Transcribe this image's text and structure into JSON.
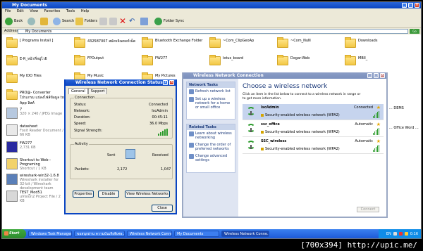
{
  "explorer": {
    "title": "My Documents",
    "menu": [
      "File",
      "Edit",
      "View",
      "Favorites",
      "Tools",
      "Help"
    ],
    "toolbar": {
      "back": "Back",
      "search": "Search",
      "folders": "Folders",
      "folder_sync": "Folder Sync"
    },
    "address_label": "Address",
    "address_value": "My Documents",
    "go": "Go",
    "items": [
      {
        "name": "[ Programs Install ]",
        "sub": "",
        "type": "folder"
      },
      {
        "name": "432587007 สมัครอินเทอร์เน็ต",
        "sub": "",
        "type": "folder"
      },
      {
        "name": "Bluetooth Exchange Folder",
        "sub": "",
        "type": "folder"
      },
      {
        "name": "~Com_ClipGeoAp",
        "sub": "",
        "type": "folder"
      },
      {
        "name": "~Com_NuN",
        "sub": "",
        "type": "folder"
      },
      {
        "name": "Downloads",
        "sub": "",
        "type": "folder"
      },
      {
        "name": "E-R_หน้าที่หมู่ไวยิ",
        "sub": "",
        "type": "folder"
      },
      {
        "name": "FPOutput",
        "sub": "",
        "type": "folder"
      },
      {
        "name": "FW277",
        "sub": "",
        "type": "folder"
      },
      {
        "name": "lotus_board",
        "sub": "",
        "type": "folder"
      },
      {
        "name": "Dxgar-Web",
        "sub": "",
        "type": "folder"
      },
      {
        "name": "MBII_",
        "sub": "",
        "type": "folder"
      },
      {
        "name": "My IDO Files",
        "sub": "",
        "type": "folder"
      },
      {
        "name": "My Music",
        "sub": "",
        "type": "folder"
      },
      {
        "name": "My Pictures",
        "sub": "",
        "type": "folder"
      },
      {
        "name": "PRO@- Converter โปรแกรม แปลงไฟล์ข้อมูล to App ลิสต์",
        "sub": "",
        "type": "folder"
      },
      {
        "name": "7",
        "sub": "320 × 240 / JPEG Image",
        "type": "image"
      },
      {
        "name": "datasheet",
        "sub": "Foxit Reader Document / 66 KB",
        "type": "pdf"
      },
      {
        "name": "FW277",
        "sub": "2,731 KB",
        "type": "exe"
      },
      {
        "name": "Shortcut to Web--Programing",
        "sub": "Shortcut / 1 KB",
        "type": "shortcut"
      },
      {
        "name": "wireshark-win32-1.6.8",
        "sub": "Wireshark installer for 32-bit / Wireshark development team",
        "type": "installer"
      },
      {
        "name": "TEST_Mod51",
        "sub": "uVision2 Project File / 2 KB",
        "type": "project"
      }
    ],
    "right_clip": [
      "... DEMS",
      "... Office Word ..."
    ]
  },
  "status_dialog": {
    "title": "Wireless Network Connection Status",
    "tabs": [
      "General",
      "Support"
    ],
    "connection_group": "Connection",
    "rows": [
      {
        "k": "Status:",
        "v": "Connected"
      },
      {
        "k": "Network:",
        "v": "IscAdmin"
      },
      {
        "k": "Duration:",
        "v": "00:45:11"
      },
      {
        "k": "Speed:",
        "v": "36.0 Mbps"
      },
      {
        "k": "Signal Strength:",
        "v": ""
      }
    ],
    "activity_group": "Activity",
    "sent": "Sent",
    "received": "Received",
    "packets_label": "Packets:",
    "packets_sent": "2,172",
    "packets_received": "1,047",
    "btn_properties": "Properties",
    "btn_disable": "Disable",
    "btn_view": "View Wireless Networks",
    "btn_close": "Close"
  },
  "wifi_dialog": {
    "title": "Wireless Network Connection",
    "network_tasks": "Network Tasks",
    "tasks": [
      "Refresh network list",
      "Set up a wireless network for a home or small office"
    ],
    "related_tasks": "Related Tasks",
    "related": [
      "Learn about wireless networking",
      "Change the order of preferred networks",
      "Change advanced settings"
    ],
    "heading": "Choose a wireless network",
    "info": "Click an item in the list below to connect to a wireless network in range or to get more information.",
    "networks": [
      {
        "name": "IscAdmin",
        "state": "Connected",
        "security": "Security-enabled wireless network (WPA2)"
      },
      {
        "name": "ssc_office",
        "state": "Automatic",
        "security": "Security-enabled wireless network (WPA2)"
      },
      {
        "name": "SSC_wireless",
        "state": "Automatic",
        "security": "Security-enabled wireless network (WPA2)"
      }
    ],
    "connect": "Connect"
  },
  "taskbar": {
    "start": "Start",
    "tasks": [
      "Windows Task Manager",
      "ขอสนุกผ่าน ความบันเทิงพิเศษ...",
      "Wireless Network Conne...",
      "My Documents",
      "Wireless Network Conne..."
    ],
    "time": "0:16",
    "lang": "EN"
  },
  "watermark": "[700x394] http://upic.me/"
}
